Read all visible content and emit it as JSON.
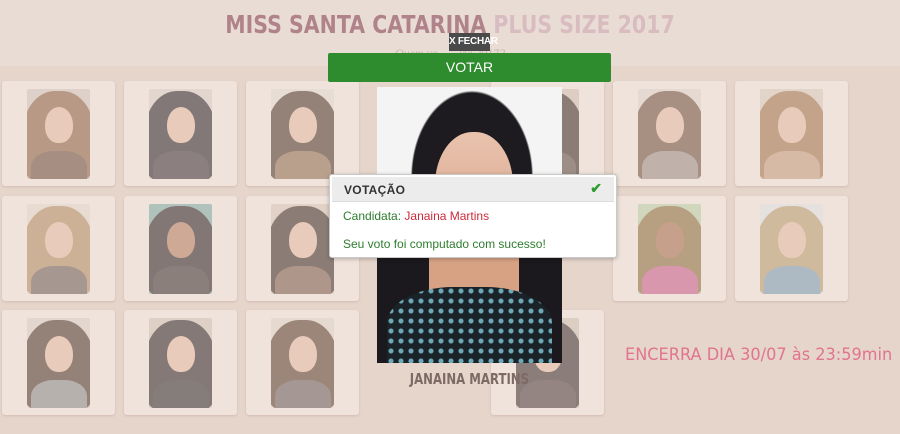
{
  "page": {
    "title_main": "MISS SANTA CATARINA",
    "title_accent": "PLUS SIZE 2017",
    "subtitle": "Quem vo... ...ize 2017?"
  },
  "countdown": {
    "text": "ENCERRA DIA 30/07 às 23:59min",
    "color": "#e2748e"
  },
  "modal": {
    "close_label": "X FECHAR",
    "vote_button": "VOTAR",
    "candidate_display_name": "JANAINA MARTINS"
  },
  "alert": {
    "title": "VOTAÇÃO",
    "status_icon": "check-icon",
    "candidate_label": "Candidata:",
    "candidate_name": "Janaina Martins",
    "message": "Seu voto foi computado com sucesso!"
  },
  "colors": {
    "vote_button": "#2e8b2e",
    "success_text": "#2e7d2e",
    "candidate_name": "#cc2a3a",
    "background": "#e9dcd4"
  }
}
